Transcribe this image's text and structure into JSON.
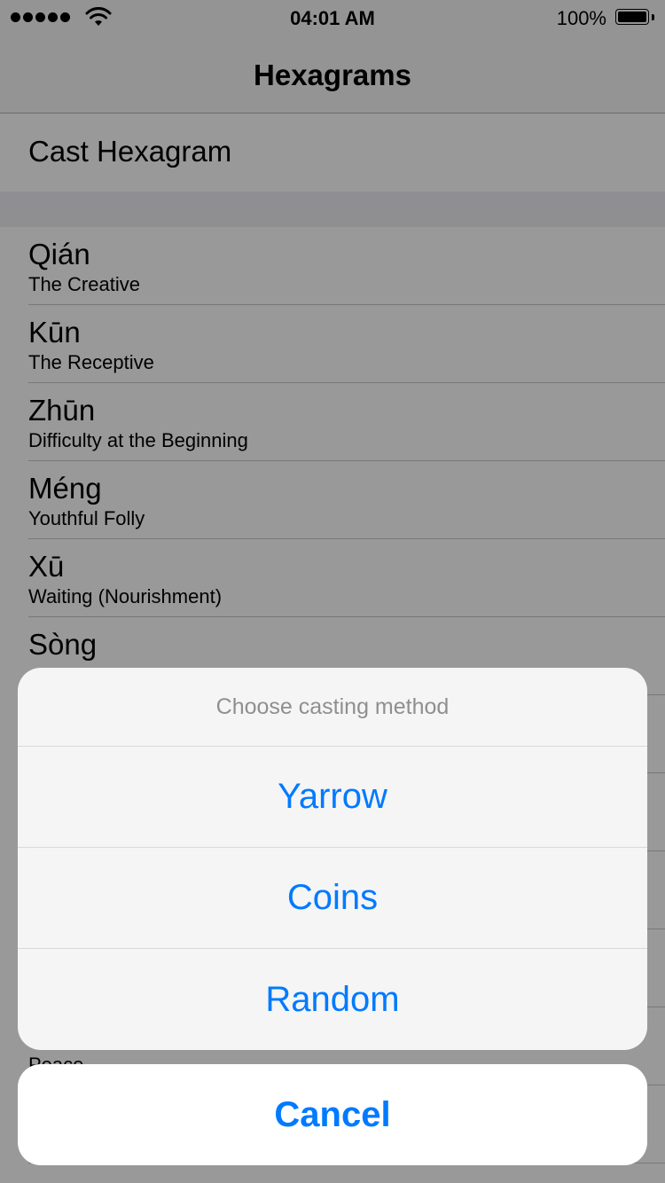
{
  "status_bar": {
    "time": "04:01 AM",
    "battery_percent": "100%",
    "battery_level": 1.0,
    "signal_bars": 5
  },
  "nav": {
    "title": "Hexagrams"
  },
  "cast": {
    "label": "Cast Hexagram"
  },
  "hexagrams": [
    {
      "name": "Qián",
      "meaning": "The Creative"
    },
    {
      "name": "Kūn",
      "meaning": "The Receptive"
    },
    {
      "name": "Zhūn",
      "meaning": "Difficulty at the Beginning"
    },
    {
      "name": "Méng",
      "meaning": "Youthful Folly"
    },
    {
      "name": "Xū",
      "meaning": "Waiting (Nourishment)"
    },
    {
      "name": "Sòng",
      "meaning": ""
    },
    {
      "name": "",
      "meaning": ""
    },
    {
      "name": "",
      "meaning": ""
    },
    {
      "name": "",
      "meaning": ""
    },
    {
      "name": "",
      "meaning": ""
    },
    {
      "name": "",
      "meaning": "Peace"
    },
    {
      "name": "",
      "meaning": ""
    }
  ],
  "action_sheet": {
    "title": "Choose casting method",
    "options": [
      "Yarrow",
      "Coins",
      "Random"
    ],
    "cancel": "Cancel"
  },
  "colors": {
    "accent": "#007aff",
    "overlay": "rgba(0,0,0,0.4)",
    "separator": "#c8c7cc"
  },
  "icons": {
    "signal": "cellular-signal-dots-icon",
    "wifi": "wifi-icon",
    "battery": "battery-icon"
  }
}
